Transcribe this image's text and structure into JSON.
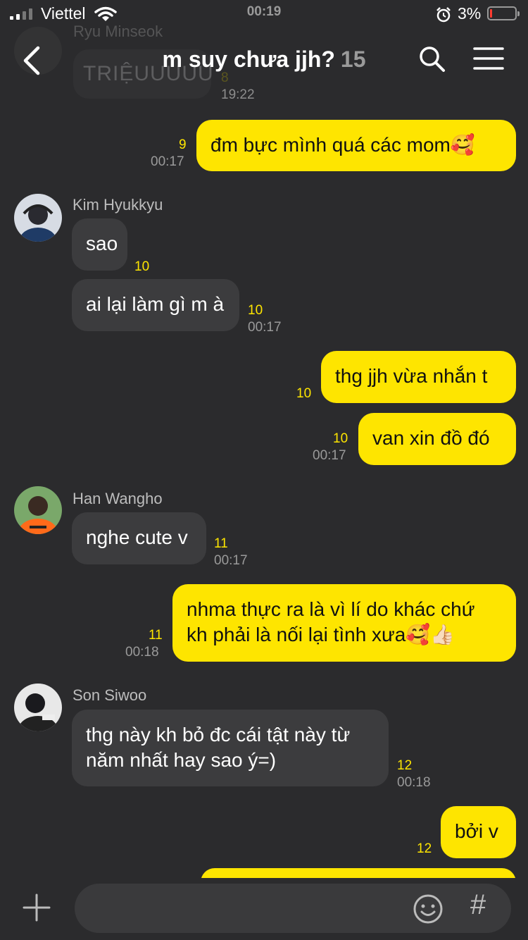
{
  "status_bar": {
    "carrier": "Viettel",
    "time": "00:19",
    "battery_percent": "3%",
    "battery_level": 0.03,
    "battery_color": "#ff3b30"
  },
  "header": {
    "title": "m suy chưa jjh?",
    "member_count": "15",
    "icons": [
      "back-arrow-icon",
      "search-icon",
      "menu-icon"
    ]
  },
  "previous_message": {
    "sender": "Ryu Minseok",
    "text": "TRIỆUUUUU",
    "unread": "8",
    "time": "19:22"
  },
  "messages": [
    {
      "direction": "out",
      "text": "đm bực mình quá các mom🥰",
      "unread": "9",
      "time": "00:17"
    },
    {
      "direction": "in",
      "sender": "Kim Hyukkyu",
      "text": "sao",
      "unread": "10",
      "time": ""
    },
    {
      "direction": "in",
      "text": "ai lại làm gì m à",
      "unread": "10",
      "time": "00:17"
    },
    {
      "direction": "out",
      "text": "thg jjh vừa nhắn t",
      "unread": "10",
      "time": ""
    },
    {
      "direction": "out",
      "text": "van xin đồ đó",
      "unread": "10",
      "time": "00:17"
    },
    {
      "direction": "in",
      "sender": "Han Wangho",
      "text": "nghe cute v",
      "unread": "11",
      "time": "00:17"
    },
    {
      "direction": "out",
      "text_lines": [
        "nhma thực ra là vì lí do khác chứ",
        "kh phải là nối lại tình xưa🥰👍🏻"
      ],
      "unread": "11",
      "time": "00:18"
    },
    {
      "direction": "in",
      "sender": "Son Siwoo",
      "text_lines": [
        "thg này kh bỏ đc cái tật này từ",
        "năm nhất hay sao ý=)"
      ],
      "unread": "12",
      "time": "00:18"
    },
    {
      "direction": "out",
      "text": "bởi v",
      "unread": "12",
      "time": ""
    }
  ],
  "composer": {
    "placeholder": "",
    "icons": [
      "plus-icon",
      "emoji-icon",
      "hashtag-icon"
    ],
    "hash_symbol": "#"
  },
  "colors": {
    "background": "#2b2b2d",
    "incoming_bubble": "#3c3c3e",
    "outgoing_bubble": "#fee500",
    "unread_count": "#fee500"
  }
}
